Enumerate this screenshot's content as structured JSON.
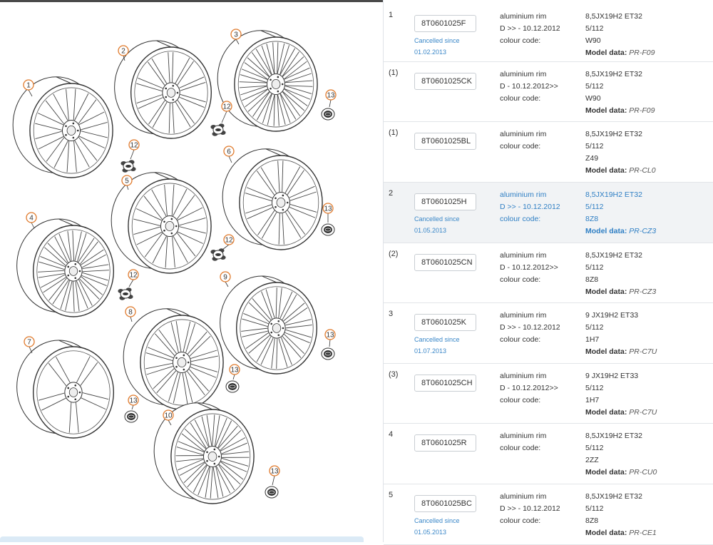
{
  "diagram": {
    "callouts": [
      "1",
      "2",
      "3",
      "4",
      "5",
      "6",
      "7",
      "8",
      "9",
      "10",
      "12",
      "13"
    ]
  },
  "parts": [
    {
      "pos": "1",
      "part_no": "8T0601025F",
      "cancelled": [
        "Cancelled since",
        "01.02.2013"
      ],
      "labels": [
        "aluminium rim",
        "D >> - 10.12.2012",
        "colour code:"
      ],
      "values": [
        "8,5JX19H2 ET32",
        "5/112",
        "W90"
      ],
      "model_label": "Model data:",
      "model_code": "PR-F09",
      "selected": false
    },
    {
      "pos": "(1)",
      "part_no": "8T0601025CK",
      "cancelled": [],
      "labels": [
        "aluminium rim",
        "D - 10.12.2012>>",
        "colour code:"
      ],
      "values": [
        "8,5JX19H2 ET32",
        "5/112",
        "W90"
      ],
      "model_label": "Model data:",
      "model_code": "PR-F09",
      "selected": false
    },
    {
      "pos": "(1)",
      "part_no": "8T0601025BL",
      "cancelled": [],
      "labels": [
        "aluminium rim",
        "colour code:"
      ],
      "values": [
        "8,5JX19H2 ET32",
        "5/112",
        "Z49"
      ],
      "model_label": "Model data:",
      "model_code": "PR-CL0",
      "selected": false
    },
    {
      "pos": "2",
      "part_no": "8T0601025H",
      "cancelled": [
        "Cancelled since",
        "01.05.2013"
      ],
      "labels": [
        "aluminium rim",
        "D >> - 10.12.2012",
        "colour code:"
      ],
      "values": [
        "8,5JX19H2 ET32",
        "5/112",
        "8Z8"
      ],
      "model_label": "Model data:",
      "model_code": "PR-CZ3",
      "selected": true
    },
    {
      "pos": "(2)",
      "part_no": "8T0601025CN",
      "cancelled": [],
      "labels": [
        "aluminium rim",
        "D - 10.12.2012>>",
        "colour code:"
      ],
      "values": [
        "8,5JX19H2 ET32",
        "5/112",
        "8Z8"
      ],
      "model_label": "Model data:",
      "model_code": "PR-CZ3",
      "selected": false
    },
    {
      "pos": "3",
      "part_no": "8T0601025K",
      "cancelled": [
        "Cancelled since",
        "01.07.2013"
      ],
      "labels": [
        "aluminium rim",
        "D >> - 10.12.2012",
        "colour code:"
      ],
      "values": [
        "9 JX19H2 ET33",
        "5/112",
        "1H7"
      ],
      "model_label": "Model data:",
      "model_code": "PR-C7U",
      "selected": false
    },
    {
      "pos": "(3)",
      "part_no": "8T0601025CH",
      "cancelled": [],
      "labels": [
        "aluminium rim",
        "D - 10.12.2012>>",
        "colour code:"
      ],
      "values": [
        "9 JX19H2 ET33",
        "5/112",
        "1H7"
      ],
      "model_label": "Model data:",
      "model_code": "PR-C7U",
      "selected": false
    },
    {
      "pos": "4",
      "part_no": "8T0601025R",
      "cancelled": [],
      "labels": [
        "aluminium rim",
        "colour code:"
      ],
      "values": [
        "8,5JX19H2 ET32",
        "5/112",
        "2ZZ"
      ],
      "model_label": "Model data:",
      "model_code": "PR-CU0",
      "selected": false
    },
    {
      "pos": "5",
      "part_no": "8T0601025BC",
      "cancelled": [
        "Cancelled since",
        "01.05.2013"
      ],
      "labels": [
        "aluminium rim",
        "D >> - 10.12.2012",
        "colour code:"
      ],
      "values": [
        "8,5JX19H2 ET32",
        "5/112",
        "8Z8"
      ],
      "model_label": "Model data:",
      "model_code": "PR-CE1",
      "selected": false
    }
  ]
}
